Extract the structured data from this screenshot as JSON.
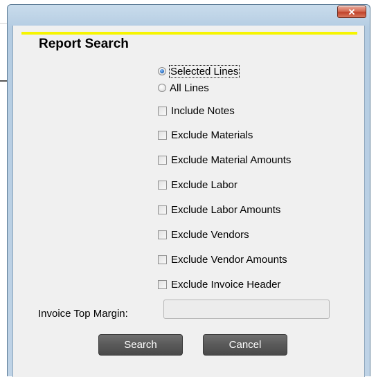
{
  "window": {
    "close_glyph": "✕"
  },
  "dialog": {
    "title": "Report Search",
    "accent_color": "#f6f500"
  },
  "scope": {
    "options": [
      {
        "label": "Selected Lines",
        "selected": true
      },
      {
        "label": "All Lines",
        "selected": false
      }
    ]
  },
  "checkboxes": [
    {
      "label": "Include Notes",
      "checked": false
    },
    {
      "label": "Exclude Materials",
      "checked": false
    },
    {
      "label": "Exclude Material Amounts",
      "checked": false
    },
    {
      "label": "Exclude Labor",
      "checked": false
    },
    {
      "label": "Exclude Labor Amounts",
      "checked": false
    },
    {
      "label": "Exclude Vendors",
      "checked": false
    },
    {
      "label": "Exclude Vendor Amounts",
      "checked": false
    },
    {
      "label": "Exclude Invoice Header",
      "checked": false
    }
  ],
  "margin": {
    "label": "Invoice Top Margin:",
    "value": "",
    "placeholder": ""
  },
  "actions": {
    "search_label": "Search",
    "cancel_label": "Cancel"
  }
}
